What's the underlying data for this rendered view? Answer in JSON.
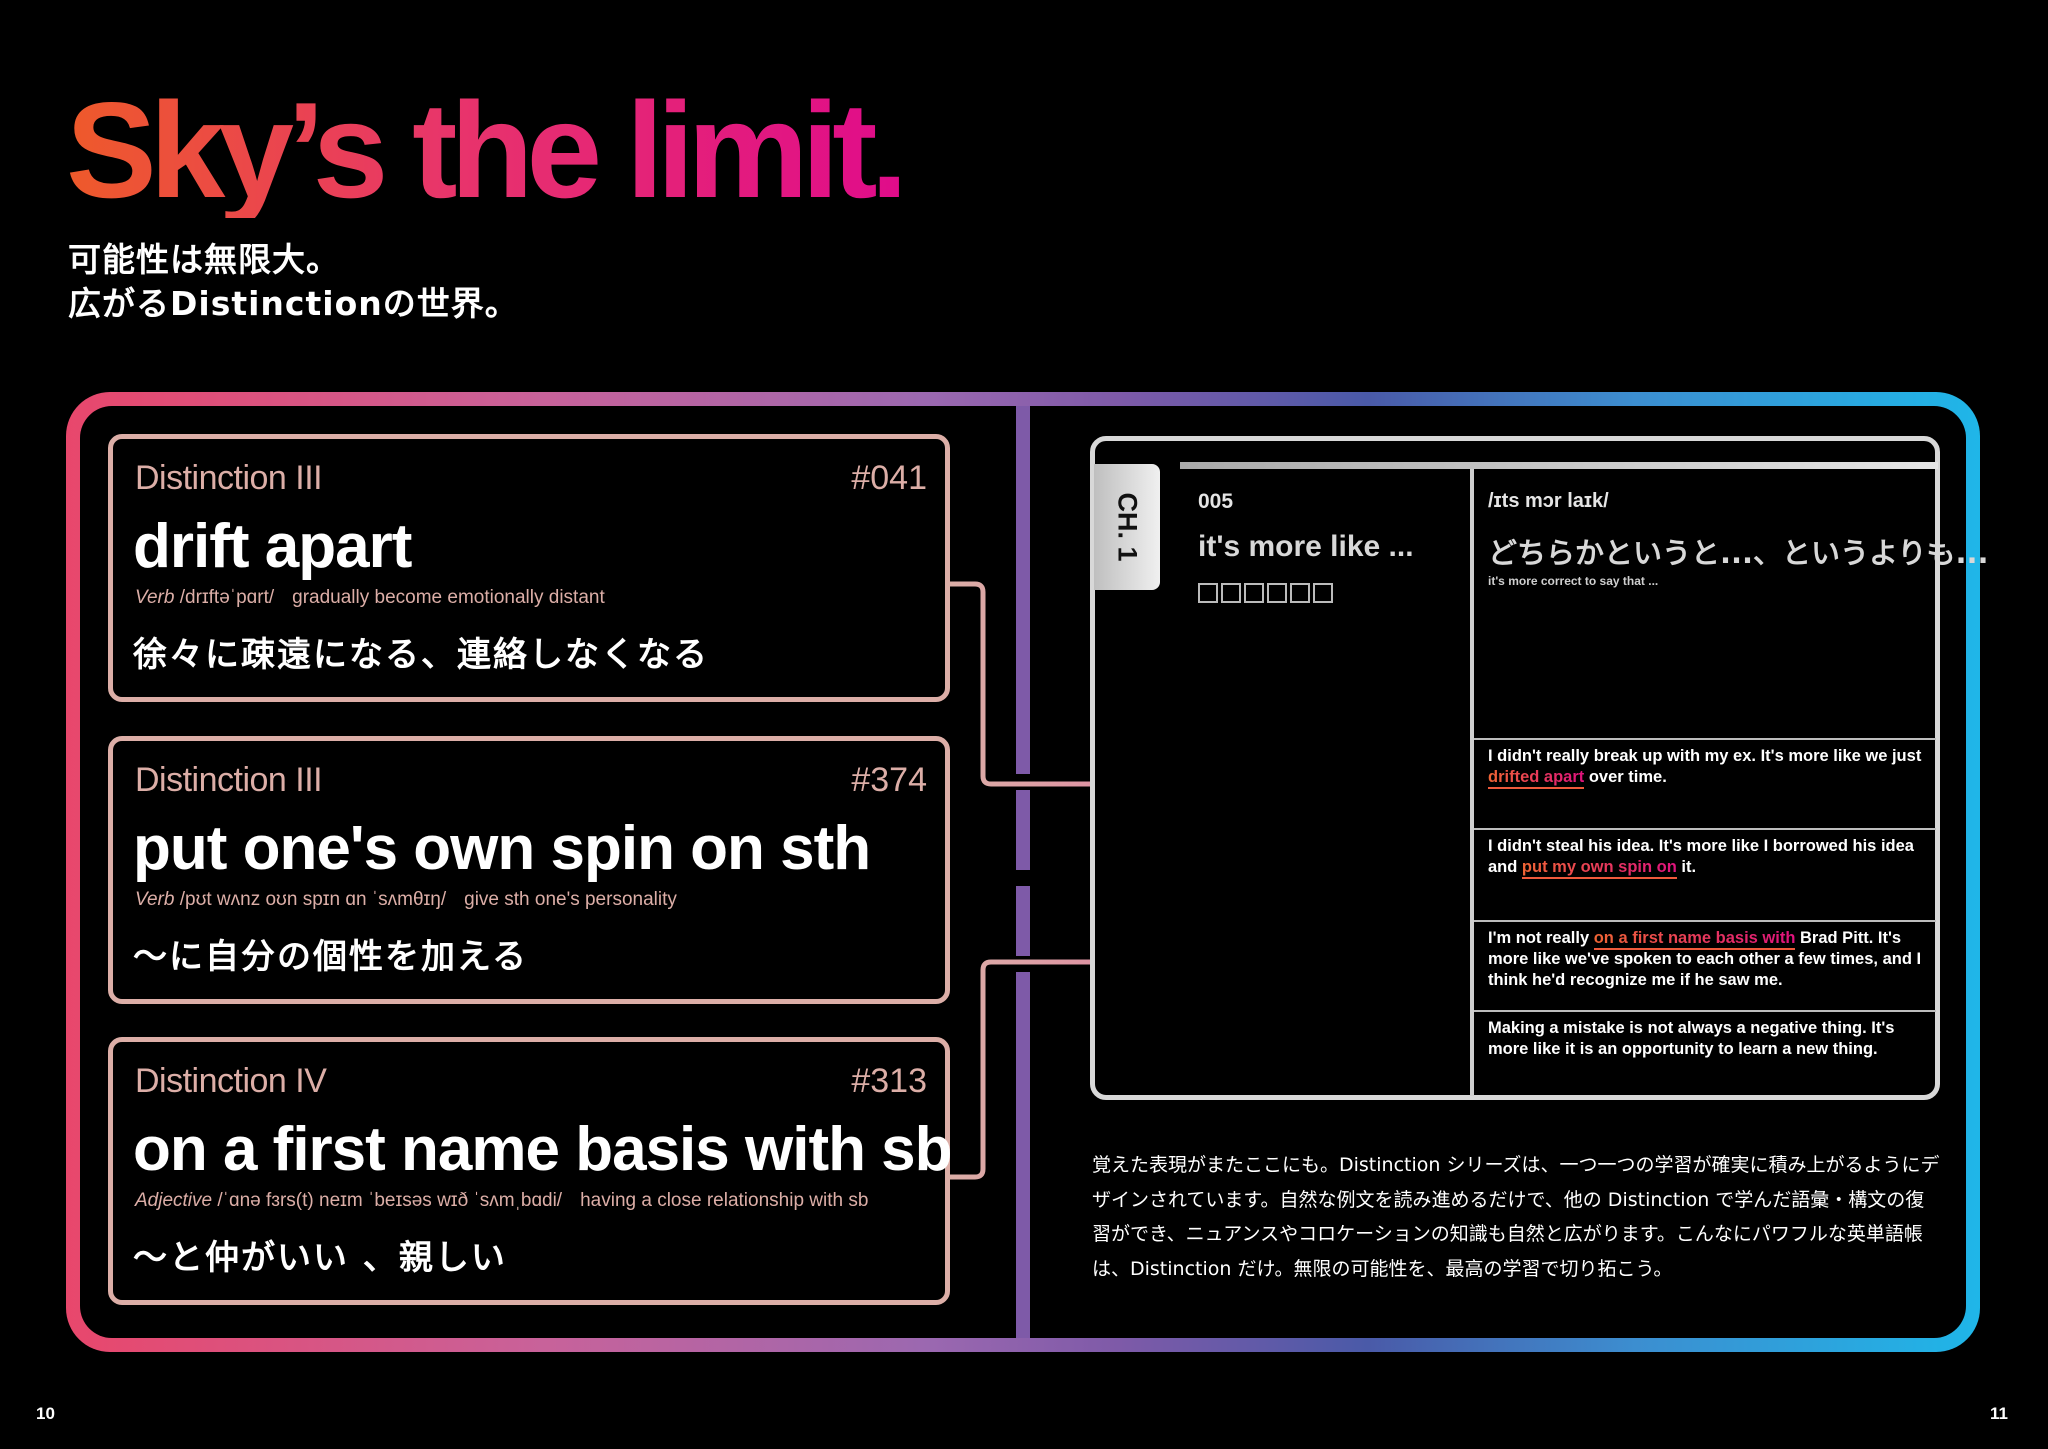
{
  "header": {
    "headline": "Sky’s the limit.",
    "subhead_line1": "可能性は無限大。",
    "subhead_line2": "広がるDistinctionの世界。"
  },
  "colors": {
    "headline_gradient": [
      "#ee5a2a",
      "#e8356a",
      "#e00c8a"
    ],
    "frame_gradient": [
      "#e8476c",
      "#9b68b0",
      "#4a5aa8",
      "#1fb6e8"
    ],
    "card_accent": "#dcaea7",
    "divider": "#7e5aa8",
    "highlight_gradient": [
      "#f06535",
      "#e0127e"
    ]
  },
  "cards": [
    {
      "series": "Distinction III",
      "number": "#041",
      "word": "drift apart",
      "pos": "Verb",
      "ipa": "/drɪftəˈpɑrt/",
      "definition": "gradually become emotionally distant",
      "japanese": "徐々に疎遠になる、連絡しなくなる"
    },
    {
      "series": "Distinction III",
      "number": "#374",
      "word": "put one's own spin on sth",
      "pos": "Verb",
      "ipa": "/pʊt wʌnz oʊn spɪn ɑn ˈsʌmθɪŋ/",
      "definition": "give sth one's personality",
      "japanese": "～に自分の個性を加える"
    },
    {
      "series": "Distinction IV",
      "number": "#313",
      "word": "on a first name basis with sb",
      "pos": "Adjective",
      "ipa": "/ˈɑnə fɜrs(t) neɪm ˈbeɪsəs wɪð ˈsʌmˌbɑdi/",
      "definition": "having a close relationship with sb",
      "japanese": "～と仲がいい 、親しい"
    }
  ],
  "book": {
    "chapter_tab": "CH. 1",
    "entry_number": "005",
    "entry_phrase": "it's more like ...",
    "entry_box_count": 6,
    "entry_ipa": "/ɪts mɔr laɪk/",
    "entry_japanese": "どちらかというと...、というよりも...",
    "entry_english": "it's more correct to say that ...",
    "examples": [
      {
        "before": "I didn't really break up with my ex. It's more like we just ",
        "highlight": "drifted apart",
        "after": " over time."
      },
      {
        "before": "I didn't steal his idea. It's more like I borrowed his idea and ",
        "highlight": "put my own spin on",
        "after": " it."
      },
      {
        "before": "I'm not really ",
        "highlight": "on a first name basis with",
        "after": " Brad Pitt. It's more like we've spoken to each other a few times, and I think he'd recognize me if he saw me."
      },
      {
        "before": "Making a mistake is not always a negative thing. It's more like it is an opportunity to learn a new thing.",
        "highlight": "",
        "after": ""
      }
    ]
  },
  "description": "覚えた表現がまたここにも。Distinction シリーズは、一つ一つの学習が確実に積み上がるようにデザインされています。自然な例文を読み進めるだけで、他の Distinction で学んだ語彙・構文の復習ができ、ニュアンスやコロケーションの知識も自然と広がります。こんなにパワフルな英単語帳は、Distinction だけ。無限の可能性を、最高の学習で切り拓こう。",
  "pages": {
    "left": "10",
    "right": "11"
  }
}
